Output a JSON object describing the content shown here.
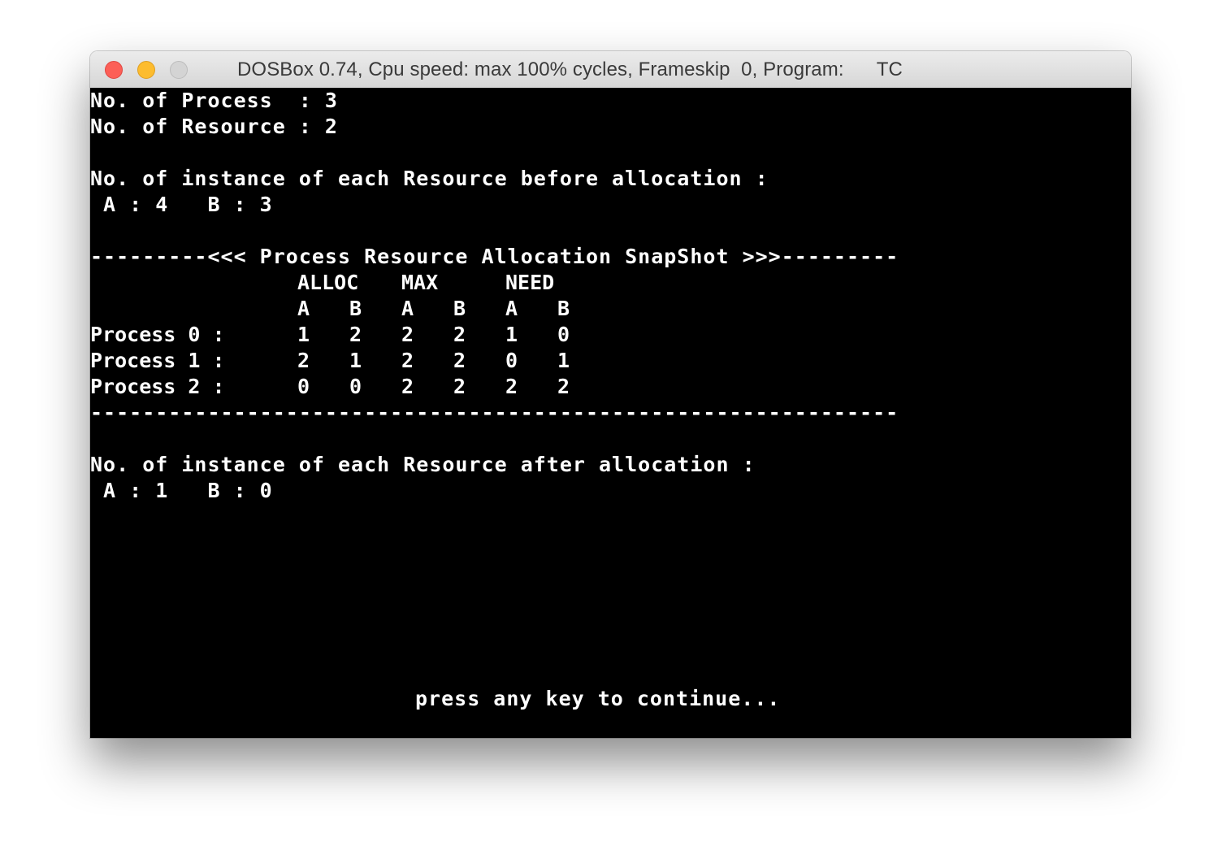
{
  "window": {
    "title": "DOSBox 0.74, Cpu speed: max 100% cycles, Frameskip  0, Program:      TC"
  },
  "terminal": {
    "process_count_line": "No. of Process  : 3",
    "resource_count_line": "No. of Resource : 2",
    "before_heading": "No. of instance of each Resource before allocation :",
    "before_values": " A : 4   B : 3",
    "snapshot_heading": "---------<<< Process Resource Allocation SnapShot >>>---------",
    "group_headers": [
      "ALLOC",
      "MAX",
      "NEED"
    ],
    "sub_headers": [
      "A",
      "B",
      "A",
      "B",
      "A",
      "B"
    ],
    "rows": [
      {
        "label": "Process 0 :",
        "values": [
          "1",
          "2",
          "2",
          "2",
          "1",
          "0"
        ]
      },
      {
        "label": "Process 1 :",
        "values": [
          "2",
          "1",
          "2",
          "2",
          "0",
          "1"
        ]
      },
      {
        "label": "Process 2 :",
        "values": [
          "0",
          "0",
          "2",
          "2",
          "2",
          "2"
        ]
      }
    ],
    "separator": "--------------------------------------------------------------",
    "after_heading": "No. of instance of each Resource after allocation :",
    "after_values": " A : 1   B : 0",
    "prompt": "press any key to continue..."
  }
}
